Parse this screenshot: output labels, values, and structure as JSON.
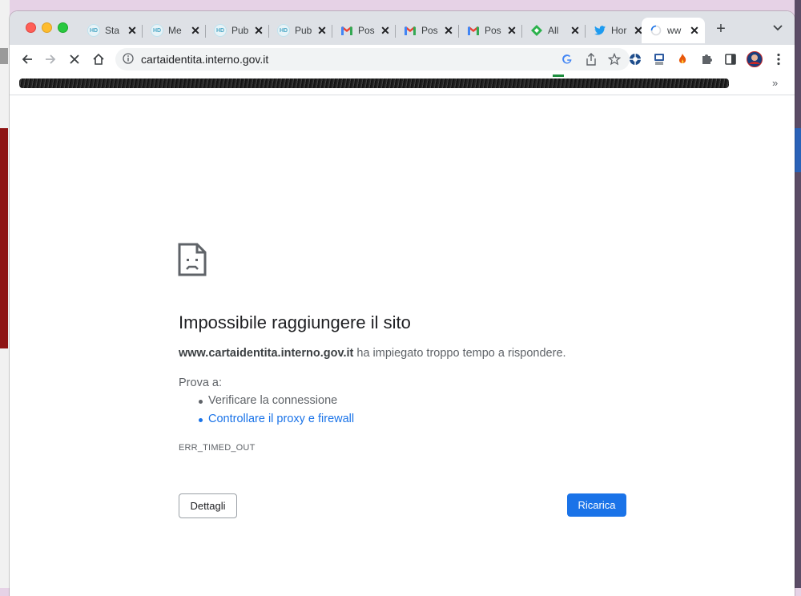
{
  "browser": {
    "tabs": [
      {
        "favicon": "hd-icon",
        "title": "Sta"
      },
      {
        "favicon": "hd-icon",
        "title": "Me"
      },
      {
        "favicon": "hd-icon",
        "title": "Pub"
      },
      {
        "favicon": "hd-icon",
        "title": "Pub"
      },
      {
        "favicon": "gmail-icon",
        "title": "Pos"
      },
      {
        "favicon": "gmail-icon",
        "title": "Pos"
      },
      {
        "favicon": "gmail-icon",
        "title": "Pos"
      },
      {
        "favicon": "feedly-icon",
        "title": "All"
      },
      {
        "favicon": "twitter-icon",
        "title": "Hor"
      },
      {
        "favicon": "loading-spinner-icon",
        "title": "ww",
        "active": true
      }
    ],
    "close_glyph": "✕",
    "new_tab_glyph": "+",
    "address": "cartaidentita.interno.gov.it",
    "bookmarks_more": "»"
  },
  "error_page": {
    "title": "Impossibile raggiungere il sito",
    "host": "www.cartaidentita.interno.gov.it",
    "description": "ha impiegato troppo tempo a rispondere.",
    "try_label": "Prova a:",
    "suggestions": [
      "Verificare la connessione",
      "Controllare il proxy e firewall"
    ],
    "error_code": "ERR_TIMED_OUT",
    "details_button": "Dettagli",
    "reload_button": "Ricarica"
  },
  "colors": {
    "accent": "#1a73e8",
    "tab_strip": "#dee1e6"
  }
}
